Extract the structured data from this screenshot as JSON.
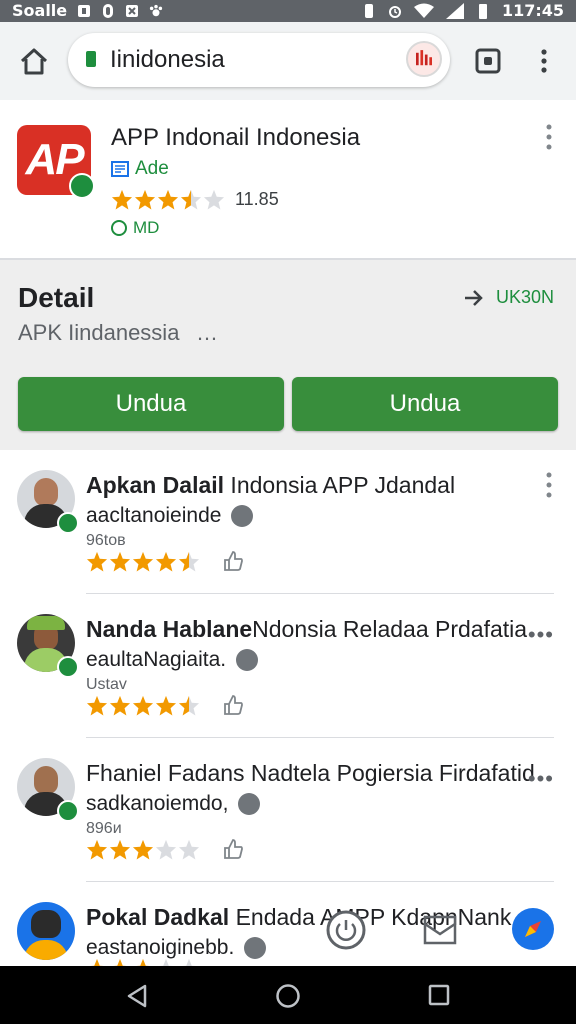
{
  "status_bar": {
    "left_text": "Soalle",
    "time": "117:45"
  },
  "browser": {
    "url": "Iinidonesia"
  },
  "app": {
    "logo_text": "AP",
    "title": "APP Indonail Indonesia",
    "developer": "Ade",
    "rating_stars": 3.5,
    "rating_count": "11.85",
    "size": "MD"
  },
  "detail": {
    "heading": "Detail",
    "subtitle": "APK Iindanessia",
    "subtitle_more": "…",
    "link_label": "UK30N",
    "buttons": [
      "Undua",
      "Undua"
    ]
  },
  "reviews": [
    {
      "name_bold": "Apkan Dalail",
      "name_rest": " Indonsia APP Jdandal",
      "handle": "aacltanoieinde",
      "meta": "96tов",
      "stars": 4.5
    },
    {
      "name_bold": "Nanda Hablane",
      "name_rest": "Ndonsia Reladaa Prdafatia",
      "handle": "eaultaNagiaita.",
      "meta": "Ustav",
      "stars": 4.5
    },
    {
      "name_bold": "",
      "name_rest": "Fhaniel Fadans Nadtela Pogiersia Firdafatid",
      "handle": "sadkanoiemdo,",
      "meta": "896и",
      "stars": 3
    },
    {
      "name_bold": "Pokal Dadkal",
      "name_rest": " Endada AMPP KdapnNank",
      "handle": "eastanoiginebb.",
      "meta": "",
      "stars": 3
    }
  ],
  "colors": {
    "accent_green": "#388e3c",
    "brand_red": "#d93025",
    "star_orange": "#f29900"
  }
}
